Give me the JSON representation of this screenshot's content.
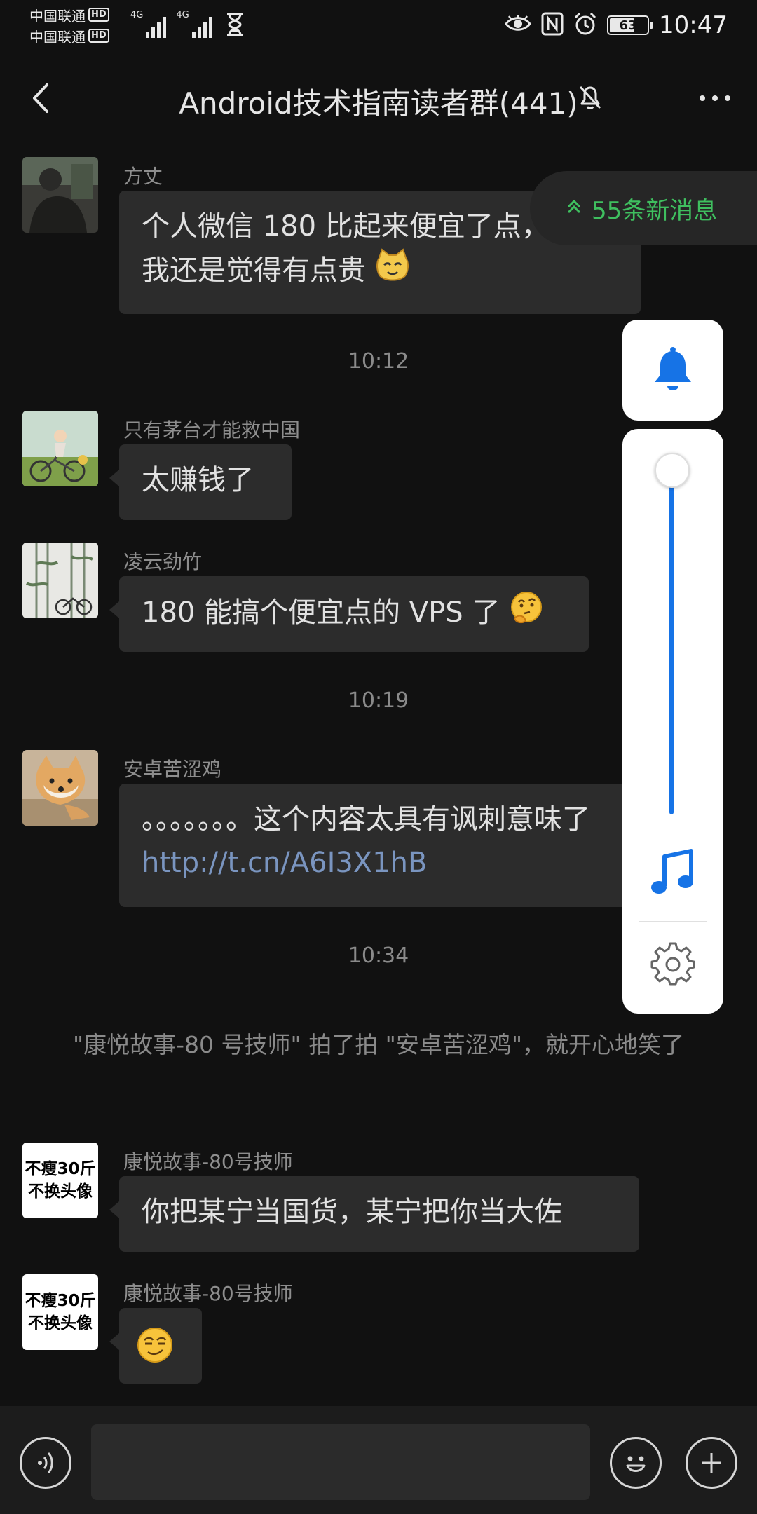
{
  "status_bar": {
    "carrier_1": "中国联通",
    "carrier_2": "中国联通",
    "hd_badge": "HD",
    "network_1": "4G",
    "network_2": "4G",
    "battery": "63",
    "battery_level": 0.63,
    "time": "10:47"
  },
  "header": {
    "title": "Android技术指南读者群(441)",
    "icons": [
      "back-arrow-icon",
      "mute-bell-icon",
      "more-dots-icon"
    ]
  },
  "new_messages": {
    "label": "55条新消息",
    "icon": "double-chevron-up-icon",
    "color": "#3fbf5f"
  },
  "messages": [
    {
      "sender": "方丈",
      "text": "个人微信 180 比起来便宜了点，不过我还是觉得有点贵",
      "emoji": "cat-emoji"
    },
    {
      "time": "10:12"
    },
    {
      "sender": "只有茅台才能救中国",
      "text": "太赚钱了"
    },
    {
      "sender": "凌云劲竹",
      "text": "180 能搞个便宜点的 VPS 了",
      "emoji": "thinking-emoji"
    },
    {
      "time": "10:19"
    },
    {
      "sender": "安卓苦涩鸡",
      "text": "。。。。。。。这个内容太具有讽刺意味了 ",
      "link": "http://t.cn/A6I3X1hB"
    },
    {
      "time": "10:34"
    },
    {
      "system": "\"康悦故事-80 号技师\" 拍了拍 \"安卓苦涩鸡\"，就开心地笑了"
    },
    {
      "sender": "康悦故事-80号技师",
      "text": "你把某宁当国货，某宁把你当大佐",
      "avatar_text": [
        "不瘦30斤",
        "不换头像"
      ]
    },
    {
      "sender": "康悦故事-80号技师",
      "emoji": "smirk-emoji",
      "avatar_text": [
        "不瘦30斤",
        "不换头像"
      ]
    }
  ],
  "volume_overlay": {
    "level": 1.0,
    "accent": "#1673e6",
    "icons": [
      "bell-icon",
      "music-note-icon",
      "gear-icon"
    ]
  },
  "input_bar": {
    "value": "",
    "icons": [
      "voice-icon",
      "emoji-icon",
      "plus-icon"
    ]
  }
}
